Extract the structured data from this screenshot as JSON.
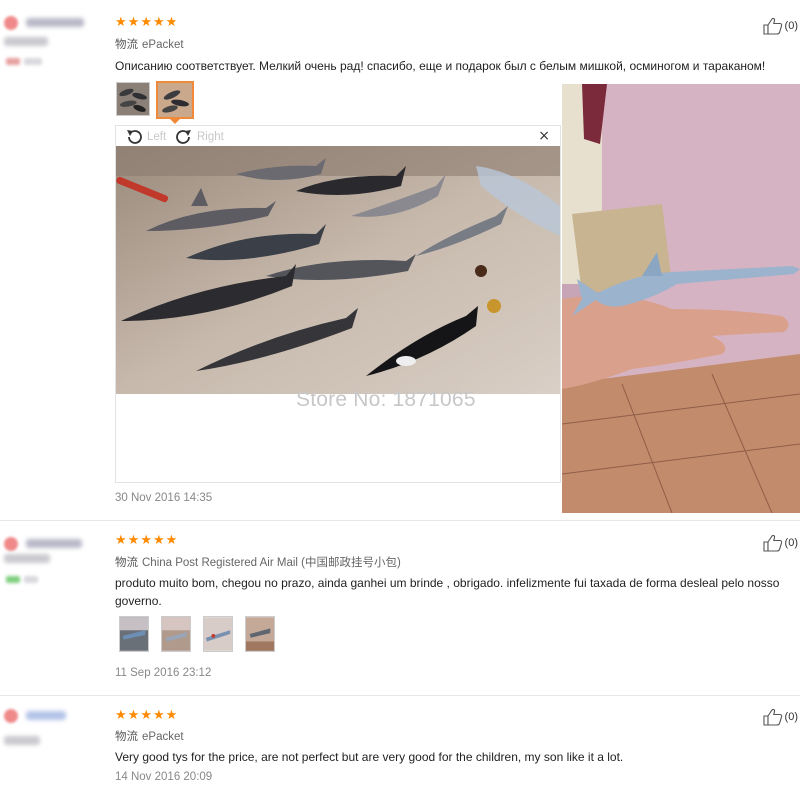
{
  "reviews": [
    {
      "rating": 5,
      "shipping_label": "物流",
      "shipping": "ePacket",
      "content": "Описанию соответствует. Мелкий очень рад! спасибо, еще и подарок был с белым мишкой, осминогом и тараканом!",
      "date": "30 Nov 2016 14:35",
      "likes": "(0)"
    },
    {
      "rating": 5,
      "shipping_label": "物流",
      "shipping": "China Post Registered Air Mail (中国邮政挂号小包)",
      "content": "produto muito bom, chegou no prazo, ainda ganhei um brinde , obrigado. infelizmente fui taxada de forma desleal pelo nosso governo.",
      "date": "11 Sep 2016 23:12",
      "likes": "(0)"
    },
    {
      "rating": 5,
      "shipping_label": "物流",
      "shipping": "ePacket",
      "content": "Very good tys for the price, are not perfect but are very good for the children, my son like it a lot.",
      "date": "14 Nov 2016 20:09",
      "likes": "(0)"
    }
  ],
  "viewer": {
    "rotate_left": "Left",
    "rotate_right": "Right",
    "close": "×"
  },
  "watermark": "Store No: 1871065",
  "colors": {
    "star": "#ff8a00",
    "active_thumb_border": "#f08a3a",
    "date_text": "#888888"
  },
  "icons": {
    "star": "star-icon",
    "like": "thumbs-up-icon",
    "rotate_left": "rotate-left-icon",
    "rotate_right": "rotate-right-icon",
    "close": "close-icon"
  }
}
